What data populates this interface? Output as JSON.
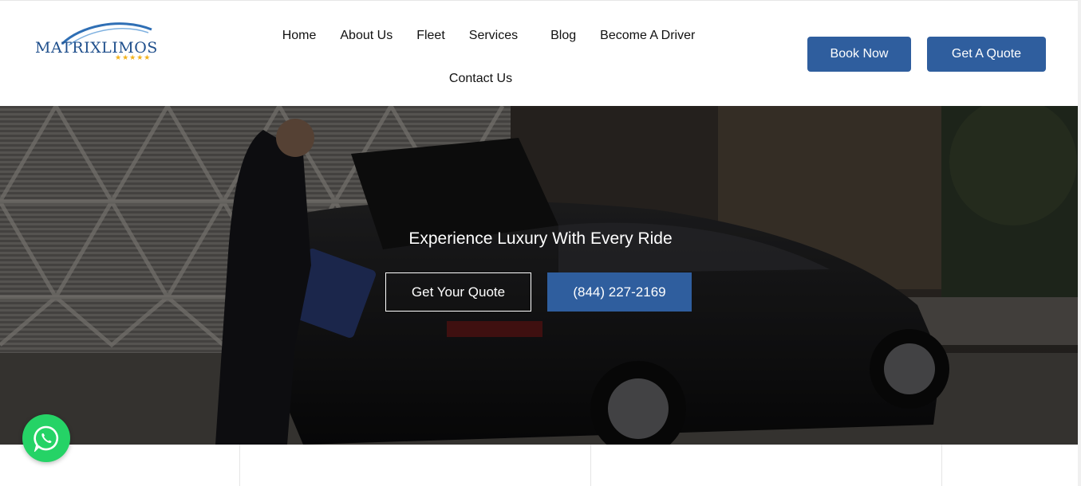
{
  "brand": {
    "name": "MATRIXLIMOS",
    "stars": "★★★★★",
    "accent_color": "#2f5e9e",
    "star_color": "#f2b21c"
  },
  "nav": {
    "items": [
      {
        "label": "Home"
      },
      {
        "label": "About Us"
      },
      {
        "label": "Fleet"
      },
      {
        "label": "Services"
      },
      {
        "label": "Blog"
      },
      {
        "label": "Become A Driver"
      },
      {
        "label": "Contact Us"
      }
    ]
  },
  "header_buttons": {
    "book_now": "Book Now",
    "get_quote": "Get A Quote"
  },
  "hero": {
    "title": "Experience Luxury With Every Ride",
    "quote_button": "Get Your Quote",
    "phone_button": "(844) 227-2169"
  },
  "floating": {
    "whatsapp_icon": "whatsapp-icon",
    "whatsapp_color": "#25d366"
  }
}
